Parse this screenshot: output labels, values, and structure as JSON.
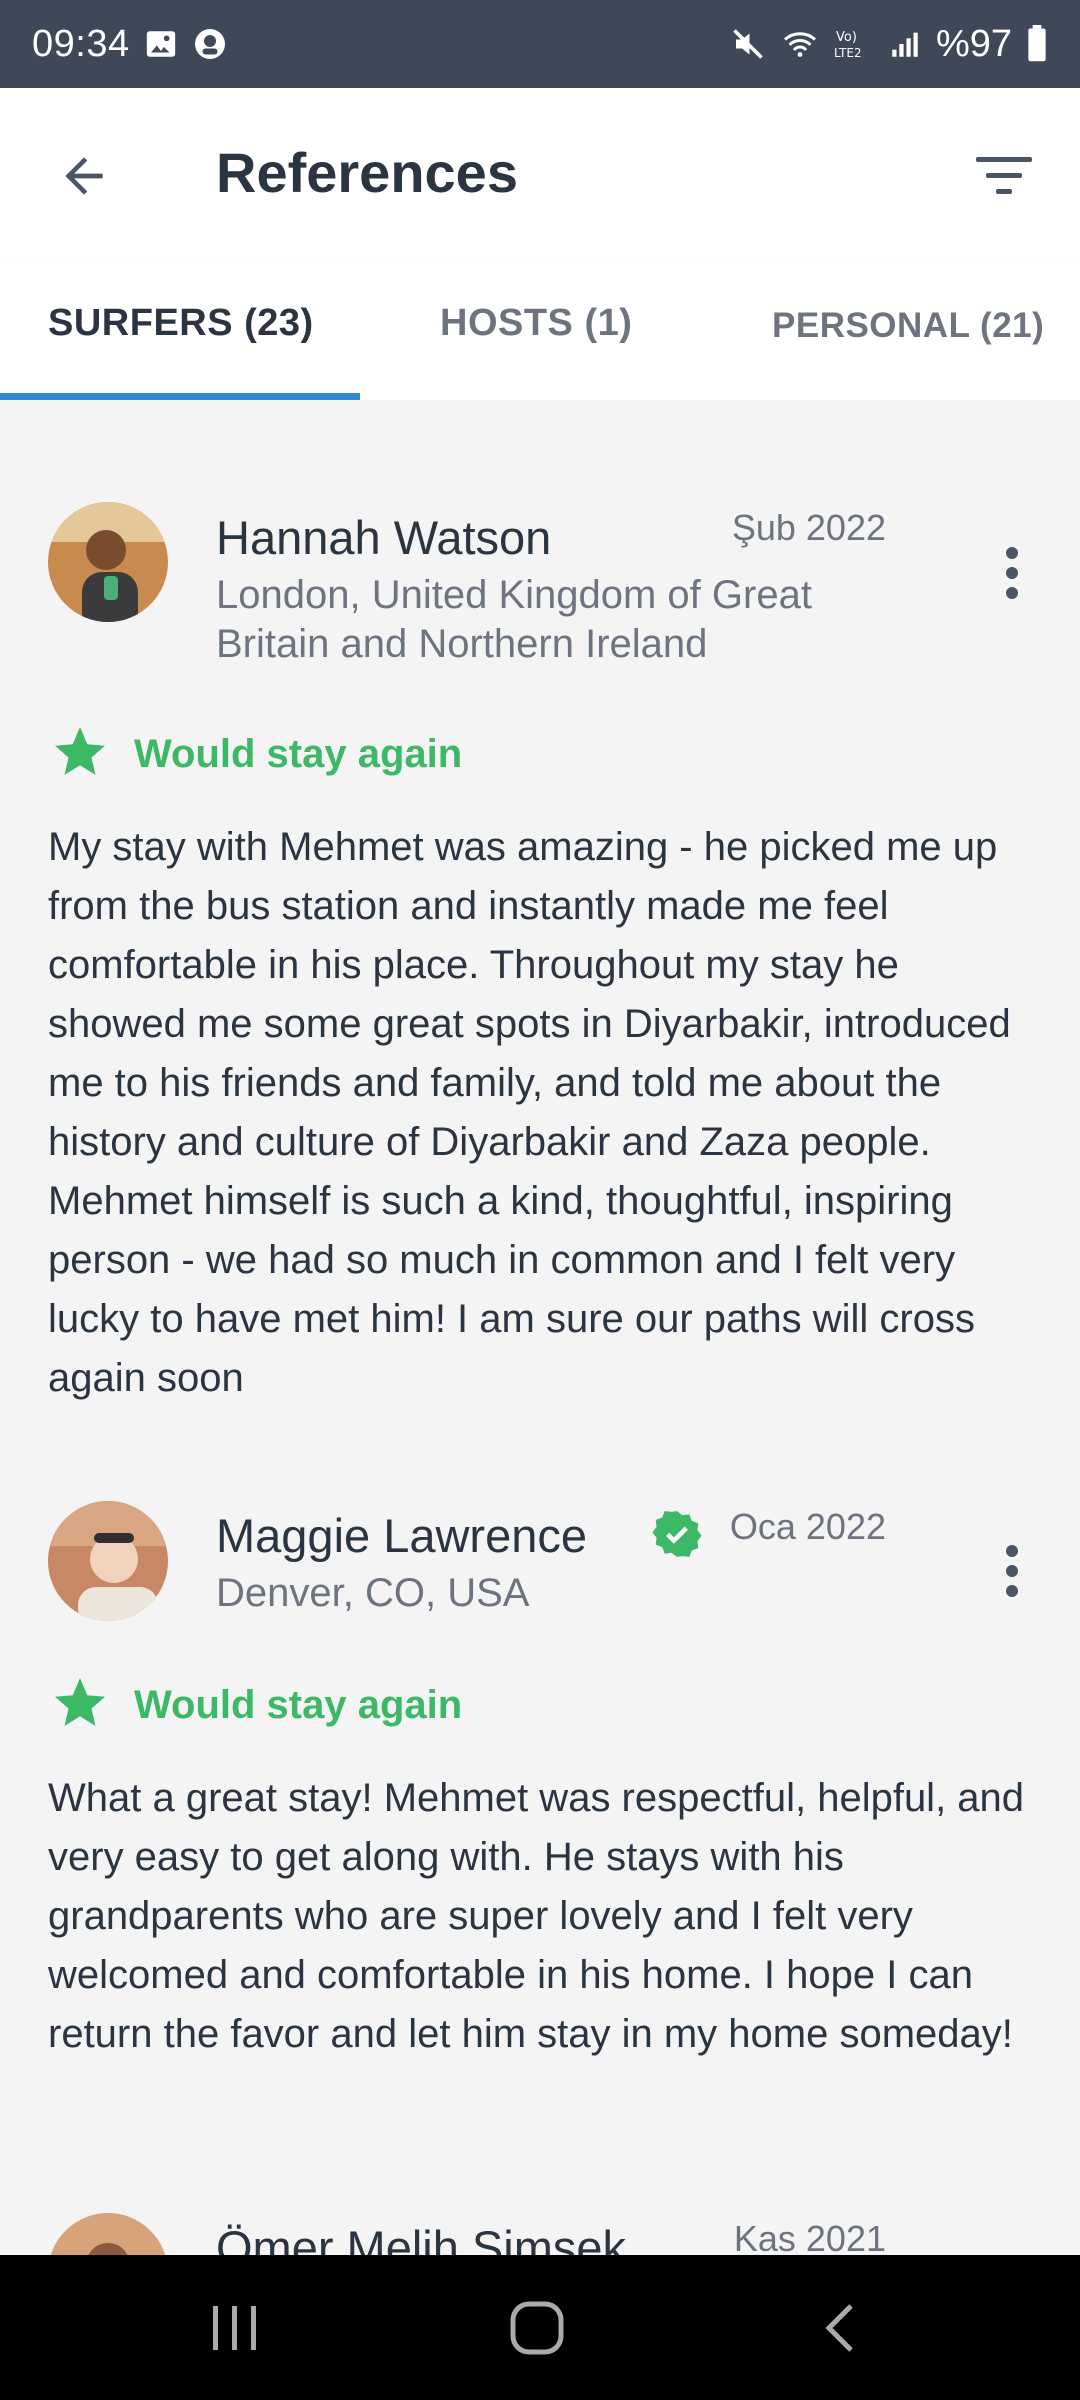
{
  "status_bar": {
    "time": "09:34",
    "battery": "%97",
    "icons": [
      "image-icon",
      "vpn-icon",
      "mute-icon",
      "wifi-icon",
      "volte-icon",
      "signal-icon",
      "battery-icon"
    ]
  },
  "header": {
    "title": "References",
    "back_icon": "arrow-left-icon",
    "filter_icon": "filter-icon"
  },
  "tabs": [
    {
      "label": "SURFERS (23)",
      "active": true
    },
    {
      "label": "HOSTS (1)",
      "active": false
    },
    {
      "label": "PERSONAL (21)",
      "active": false
    }
  ],
  "colors": {
    "status_bar": "#3f4859",
    "accent": "#2e8bd6",
    "positive": "#3cb867",
    "text_primary": "#2b3441",
    "text_secondary": "#6d7480"
  },
  "references": [
    {
      "name": "Hannah Watson",
      "date": "Şub 2022",
      "location": "London, United Kingdom of Great Britain and Northern Ireland",
      "verified": false,
      "recommendation": "Would stay again",
      "text": "My stay with Mehmet was amazing - he picked me up from the bus station and instantly made me feel comfortable in his place. Throughout my stay he showed me some great spots in Diyarbakir, introduced me to his friends and family, and told me about the history and culture of Diyarbakir and Zaza people. Mehmet himself is such a kind, thoughtful, inspiring person - we had so much in common and I felt very lucky to have met him! I am sure our paths will cross again soon"
    },
    {
      "name": "Maggie Lawrence",
      "date": "Oca 2022",
      "location": "Denver, CO, USA",
      "verified": true,
      "recommendation": "Would stay again",
      "text": "What a great stay! Mehmet was respectful, helpful, and very easy to get along with. He stays with his grandparents who are super lovely and I felt very welcomed and comfortable in his home. I hope I can return the favor and let him stay in my home someday!"
    },
    {
      "name": "Ömer Melih Şimşek",
      "date": "Kas 2021"
    }
  ]
}
